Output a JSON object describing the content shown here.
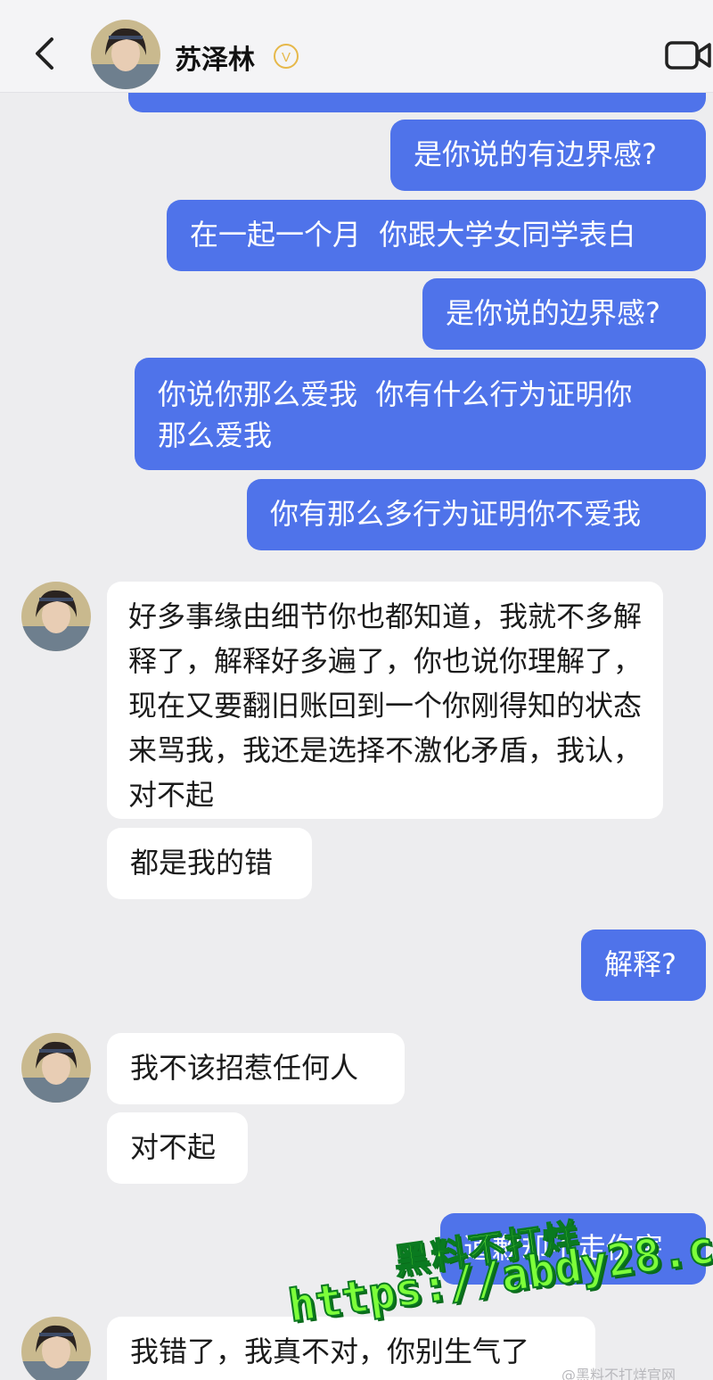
{
  "header": {
    "name": "苏泽林",
    "back_icon": "chevron-left-icon",
    "verified_icon": "verified-badge-icon",
    "video_icon": "video-call-icon",
    "verified_mark": "V"
  },
  "messages": {
    "m1": "是你说的有边界感?",
    "m2": "在一起一个月  你跟大学女同学表白",
    "m3": "是你说的边界感?",
    "m4a": "你说你那么爱我  你有什么行为证明你",
    "m4b": "那么爱我",
    "m5": "你有那么多行为证明你不爱我",
    "m6": "好多事缘由细节你也都知道，我就不多解释了，解释好多遍了，你也说你理解了，现在又要翻旧账回到一个你刚得知的状态来骂我，我还是选择不激化矛盾，我认，对不起",
    "m7": "都是我的错",
    "m8": "解释?",
    "m9": "我不该招惹任何人",
    "m10": "对不起",
    "m11": "道歉却不走伤害",
    "m12": "我错了，我真不对，你别生气了"
  },
  "watermark": {
    "line1": "黑料不打烊",
    "line2": "https://abdy28.com",
    "faint": "@黑料不打烊官网"
  },
  "colors": {
    "outgoing": "#4f73ea",
    "incoming": "#ffffff",
    "background": "#ededef",
    "watermark": "#7dff3a"
  }
}
